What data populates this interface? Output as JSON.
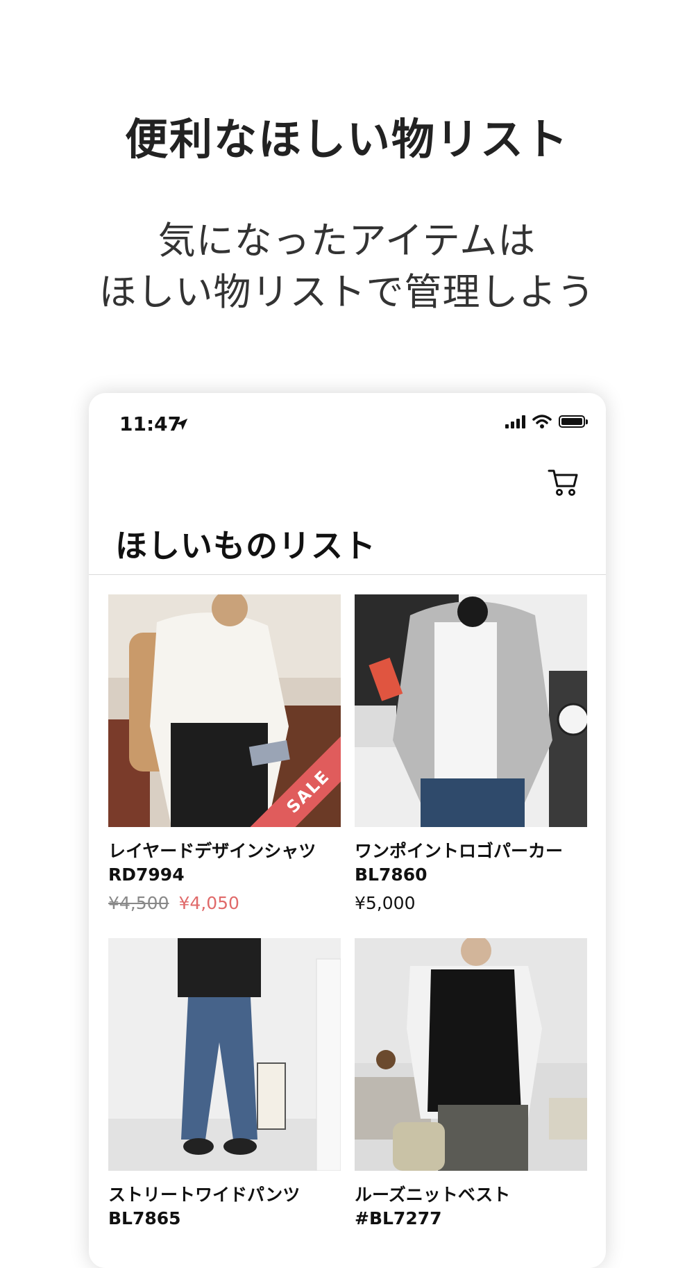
{
  "promo": {
    "headline": "便利なほしい物リスト",
    "sub_line1": "気になったアイテムは",
    "sub_line2": "ほしい物リストで管理しよう"
  },
  "status_bar": {
    "time": "11:47",
    "icons": [
      "location-arrow-icon",
      "signal-icon",
      "wifi-icon",
      "battery-icon"
    ]
  },
  "header": {
    "cart_icon": "cart-icon",
    "title": "ほしいものリスト"
  },
  "products": [
    {
      "name": "レイヤードデザインシャツ",
      "code": "RD7994",
      "original_price": "¥4,500",
      "price": "¥4,050",
      "badge": "SALE"
    },
    {
      "name": "ワンポイントロゴパーカー",
      "code": "BL7860",
      "price": "¥5,000"
    },
    {
      "name": "ストリートワイドパンツ",
      "code": "BL7865"
    },
    {
      "name": "ルーズニットベスト",
      "code": "#BL7277"
    }
  ],
  "colors": {
    "sale_price": "#e06a6a",
    "sale_badge": "#e05c5c",
    "divider": "#d9d9d9"
  }
}
